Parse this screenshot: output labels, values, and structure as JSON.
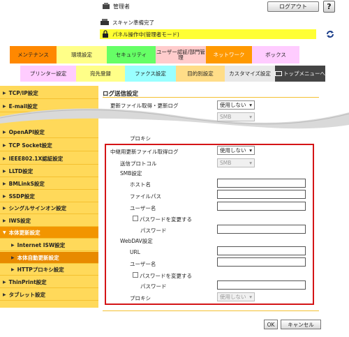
{
  "header": {
    "user": "管理者",
    "logout": "ログアウト",
    "help": "?",
    "status_scan": "スキャン準備完了",
    "status_panel": "パネル操作中(管理者モード)"
  },
  "tabs": [
    {
      "label": "メンテナンス",
      "color": "#ff8800"
    },
    {
      "label": "環境設定",
      "color": "#ffff88"
    },
    {
      "label": "セキュリティ",
      "color": "#66ff66"
    },
    {
      "label": "ユーザー認証/部門管理",
      "color": "#ffcccc"
    },
    {
      "label": "ネットワーク",
      "color": "#ff9900"
    },
    {
      "label": "ボックス",
      "color": "#ffccff"
    }
  ],
  "subtabs": [
    {
      "label": "プリンター設定",
      "color": "#ffccff"
    },
    {
      "label": "宛先登録",
      "color": "#ffff88"
    },
    {
      "label": "ファクス設定",
      "color": "#99ffff"
    },
    {
      "label": "目的別設定",
      "color": "#ffdd88"
    },
    {
      "label": "カスタマイズ設定",
      "color": "#e8e8e8"
    },
    {
      "label": "トップメニューへ",
      "color": "#444444"
    }
  ],
  "sidebar": {
    "items": [
      {
        "label": "TCP/IP設定"
      },
      {
        "label": "E-mail設定"
      },
      {
        "label": "OpenAPI設定"
      },
      {
        "label": "TCP Socket設定"
      },
      {
        "label": "IEEE802.1X認証設定"
      },
      {
        "label": "LLTD設定"
      },
      {
        "label": "BMLinkS設定"
      },
      {
        "label": "SSDP設定"
      },
      {
        "label": "シングルサインオン設定"
      },
      {
        "label": "IWS設定"
      },
      {
        "label": "本体更新設定"
      },
      {
        "label": "Internet ISW設定"
      },
      {
        "label": "本体自動更新設定"
      },
      {
        "label": "HTTPプロキシ設定"
      },
      {
        "label": "ThinPrint設定"
      },
      {
        "label": "タブレット設定"
      }
    ]
  },
  "main": {
    "title": "ログ送信設定",
    "update_log_label": "更新ファイル取得・更新ログ",
    "update_log_value": "使用しない",
    "smb_partial_value": "SMB",
    "proxy_top_label": "プロキシ",
    "relay_label": "中継用更新ファイル取得ログ",
    "relay_value": "使用しない",
    "protocol_label": "送信プロトコル",
    "protocol_value": "SMB",
    "smb_section": "SMB設定",
    "host_label": "ホスト名",
    "path_label": "ファイルパス",
    "user_label": "ユーザー名",
    "change_pw_label": "パスワードを変更する",
    "pw_label": "パスワード",
    "webdav_section": "WebDAV設定",
    "url_label": "URL",
    "webdav_user_label": "ユーザー名",
    "webdav_change_pw_label": "パスワードを変更する",
    "webdav_pw_label": "パスワード",
    "proxy_label": "プロキシ",
    "proxy_value": "使用しない",
    "ok": "OK",
    "cancel": "キャンセル"
  }
}
